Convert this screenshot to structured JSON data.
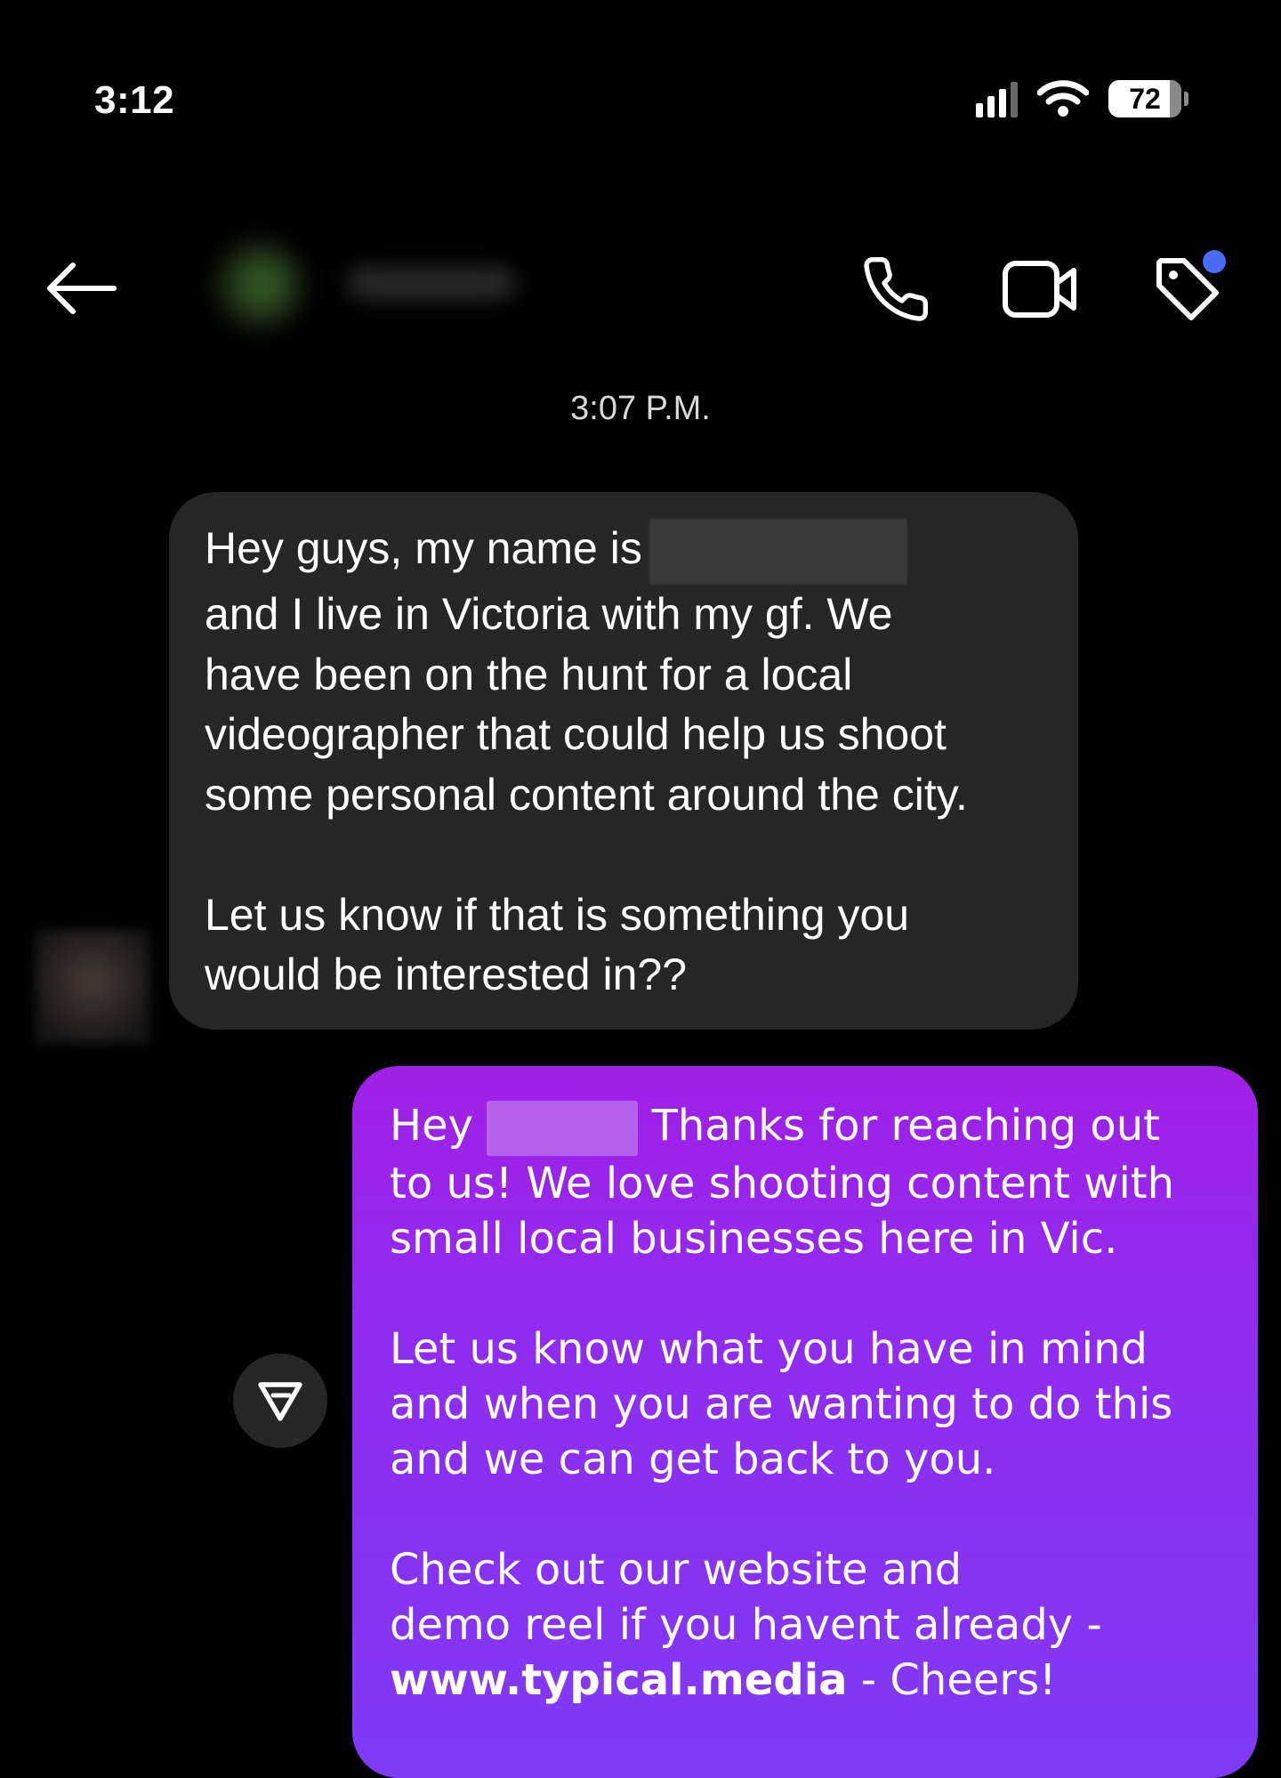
{
  "status_bar": {
    "time": "3:12",
    "battery_level": "72",
    "signal_bars": 4,
    "icons": [
      "signal-icon",
      "wifi-icon",
      "battery-icon"
    ]
  },
  "header": {
    "icons": [
      "back-arrow-icon",
      "phone-icon",
      "video-camera-icon",
      "tag-icon"
    ],
    "tag_badge_color": "#4a6cf7"
  },
  "thread": {
    "timestamp": "3:07 P.M.",
    "incoming": {
      "lines": [
        "Hey guys, my name is",
        "and I live in Victoria with my gf. We",
        "have been on the hunt for a local",
        "videographer that could help us shoot",
        "some personal content around the city.",
        "Let us know if that is something you",
        "would be interested in??"
      ],
      "bubble_color": "#262626"
    },
    "outgoing": {
      "line1_prefix": "Hey",
      "line1_suffix": "Thanks for reaching out",
      "lines_a": [
        "to us! We love shooting content with",
        "small local businesses here in Vic."
      ],
      "lines_b": [
        "Let us know what you have in mind",
        "and when you are wanting to do this",
        "and we can get back to you."
      ],
      "lines_c": [
        "Check out our website and",
        "demo reel if you havent already -"
      ],
      "link_text": "www.typical.media",
      "link_suffix": " - Cheers!",
      "bubble_gradient": [
        "#a020e6",
        "#7f3af4"
      ]
    },
    "share_icon": "send-triangle-icon"
  }
}
